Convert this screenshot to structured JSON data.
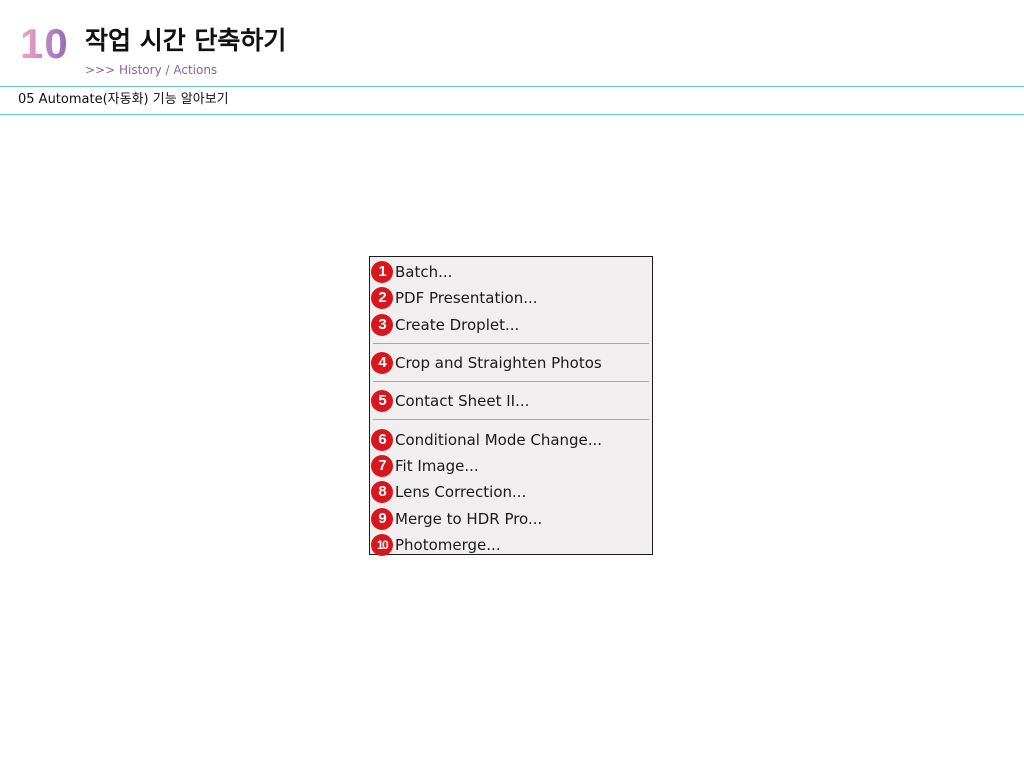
{
  "header": {
    "chapter_number": "10",
    "title": "작업 시간 단축하기",
    "subtitle": ">>> History / Actions"
  },
  "section": {
    "title": "05 Automate(자동화) 기능 알아보기"
  },
  "menu": {
    "items": [
      {
        "num": "1",
        "label": "Batch..."
      },
      {
        "num": "2",
        "label": "PDF Presentation..."
      },
      {
        "num": "3",
        "label": "Create Droplet..."
      },
      {
        "num": "4",
        "label": "Crop and Straighten Photos"
      },
      {
        "num": "5",
        "label": "Contact Sheet II..."
      },
      {
        "num": "6",
        "label": "Conditional Mode Change..."
      },
      {
        "num": "7",
        "label": "Fit Image..."
      },
      {
        "num": "8",
        "label": "Lens Correction..."
      },
      {
        "num": "9",
        "label": "Merge to HDR Pro..."
      },
      {
        "num": "10",
        "label": "Photomerge..."
      }
    ]
  },
  "colors": {
    "badge": "#d8161d",
    "rule": "#62c9c0",
    "subtitle": "#8a64a6",
    "menu_bg": "#f0eeee"
  }
}
